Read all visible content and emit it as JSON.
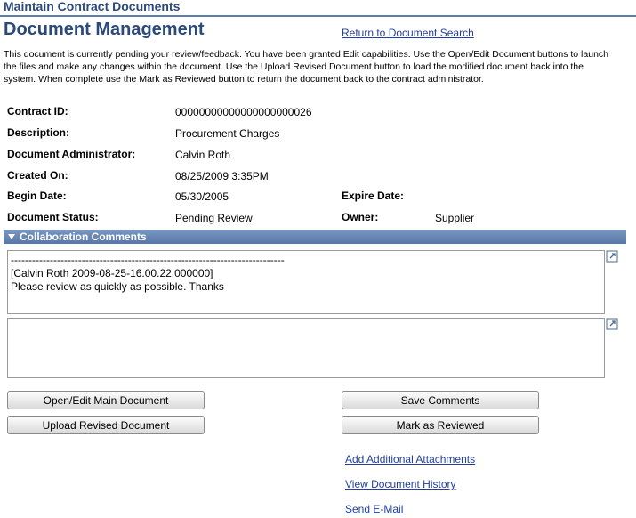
{
  "header": {
    "title": "Maintain Contract Documents"
  },
  "page": {
    "title": "Document Management",
    "return_link": "Return to Document Search",
    "instructions": "This document is currently pending your review/feedback.  You have been granted Edit capabilities.   Use the Open/Edit Document buttons to launch the files and make any changes within the document.   Use the Upload Revised Document button to load the modified document back into the system.    When complete use the Mark as Reviewed button to return the document back to the contract administrator."
  },
  "fields": {
    "contract_id": {
      "label": "Contract ID:",
      "value": "00000000000000000000026"
    },
    "description": {
      "label": "Description:",
      "value": "Procurement Charges"
    },
    "administrator": {
      "label": "Document Administrator:",
      "value": "Calvin Roth"
    },
    "created_on": {
      "label": "Created On:",
      "value": "08/25/2009  3:35PM"
    },
    "begin_date": {
      "label": "Begin Date:",
      "value": "05/30/2005"
    },
    "expire_date": {
      "label": "Expire Date:",
      "value": ""
    },
    "status": {
      "label": "Document Status:",
      "value": "Pending Review"
    },
    "owner": {
      "label": "Owner:",
      "value": "Supplier"
    }
  },
  "collaboration": {
    "section_title": "Collaboration Comments",
    "existing_comments": "-----------------------------------------------------------------------------\n[Calvin Roth 2009-08-25-16.00.22.000000]\nPlease review as quickly as possible.  Thanks",
    "new_comment": ""
  },
  "buttons": {
    "open_edit": "Open/Edit Main Document",
    "upload": "Upload Revised Document",
    "save_comments": "Save Comments",
    "mark_reviewed": "Mark as Reviewed"
  },
  "links": {
    "attachments": "Add Additional Attachments",
    "history": "View Document History",
    "email": "Send E-Mail"
  },
  "colors": {
    "title": "#2b4a7a",
    "section_bar": "#5676a6",
    "link": "#2340a0"
  }
}
